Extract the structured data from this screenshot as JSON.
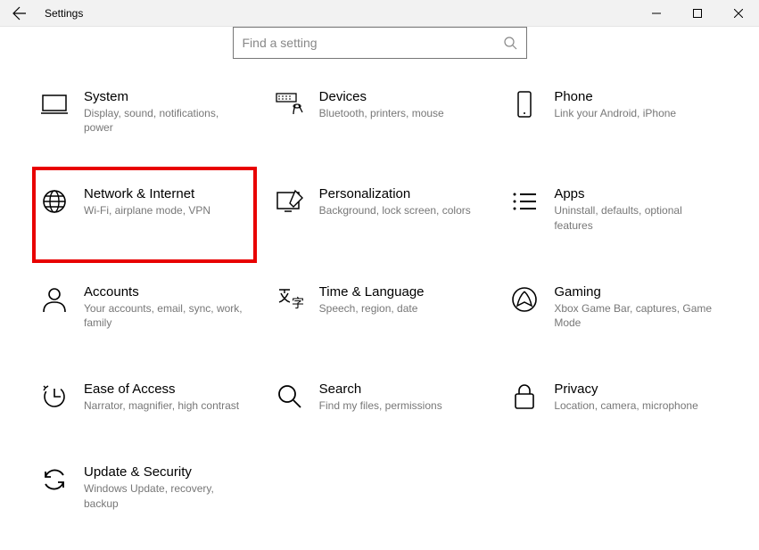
{
  "titlebar": {
    "title": "Settings"
  },
  "search": {
    "placeholder": "Find a setting"
  },
  "categories": [
    {
      "title": "System",
      "sub": "Display, sound, notifications, power"
    },
    {
      "title": "Devices",
      "sub": "Bluetooth, printers, mouse"
    },
    {
      "title": "Phone",
      "sub": "Link your Android, iPhone"
    },
    {
      "title": "Network & Internet",
      "sub": "Wi-Fi, airplane mode, VPN"
    },
    {
      "title": "Personalization",
      "sub": "Background, lock screen, colors"
    },
    {
      "title": "Apps",
      "sub": "Uninstall, defaults, optional features"
    },
    {
      "title": "Accounts",
      "sub": "Your accounts, email, sync, work, family"
    },
    {
      "title": "Time & Language",
      "sub": "Speech, region, date"
    },
    {
      "title": "Gaming",
      "sub": "Xbox Game Bar, captures, Game Mode"
    },
    {
      "title": "Ease of Access",
      "sub": "Narrator, magnifier, high contrast"
    },
    {
      "title": "Search",
      "sub": "Find my files, permissions"
    },
    {
      "title": "Privacy",
      "sub": "Location, camera, microphone"
    },
    {
      "title": "Update & Security",
      "sub": "Windows Update, recovery, backup"
    }
  ]
}
